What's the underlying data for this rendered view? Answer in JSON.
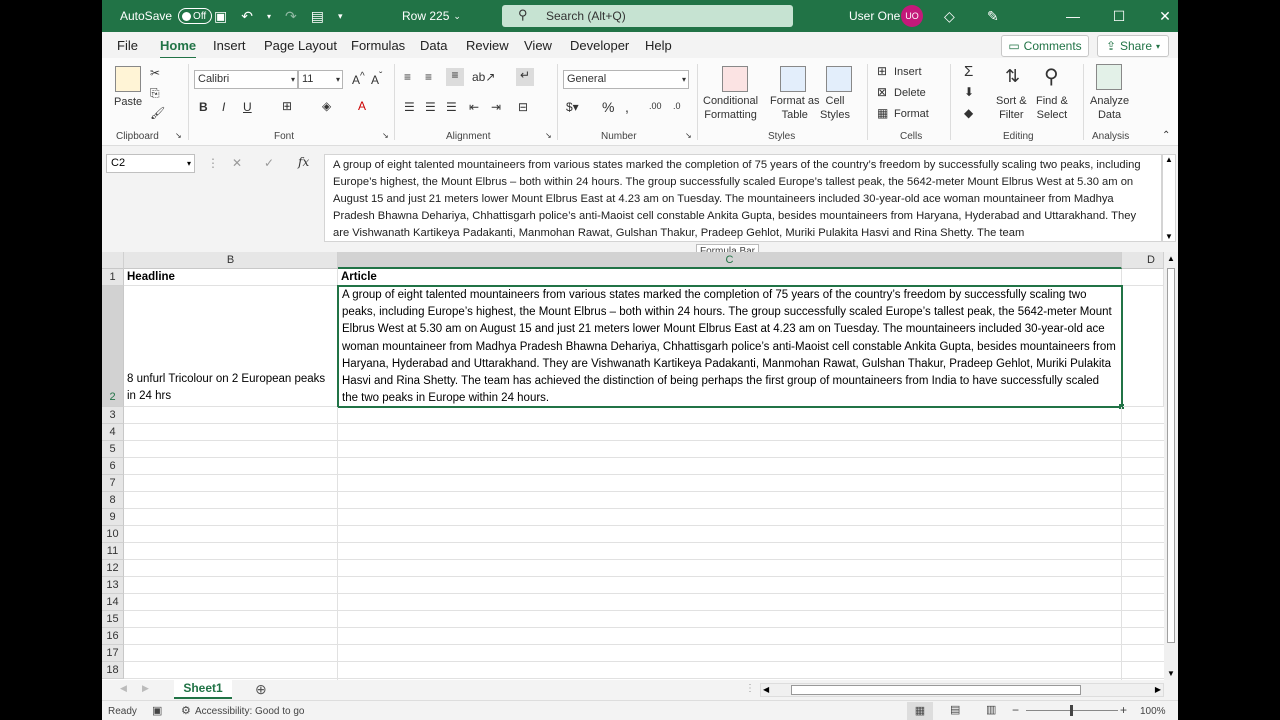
{
  "titlebar": {
    "autosave_label": "AutoSave",
    "autosave_state": "Off",
    "doc_title": "Row 225",
    "search_placeholder": "Search (Alt+Q)",
    "user_name": "User One",
    "user_initials": "UO"
  },
  "menu": {
    "tabs": [
      "File",
      "Home",
      "Insert",
      "Page Layout",
      "Formulas",
      "Data",
      "Review",
      "View",
      "Developer",
      "Help"
    ],
    "active": "Home",
    "comments": "Comments",
    "share": "Share"
  },
  "ribbon": {
    "clipboard": {
      "paste": "Paste",
      "label": "Clipboard"
    },
    "font": {
      "name": "Calibri",
      "size": "11",
      "label": "Font"
    },
    "alignment": {
      "label": "Alignment"
    },
    "number": {
      "format": "General",
      "label": "Number"
    },
    "styles": {
      "conditional_l1": "Conditional",
      "conditional_l2": "Formatting",
      "format_table_l1": "Format as",
      "format_table_l2": "Table",
      "cell_styles_l1": "Cell",
      "cell_styles_l2": "Styles",
      "label": "Styles"
    },
    "cells": {
      "insert": "Insert",
      "delete": "Delete",
      "format": "Format",
      "label": "Cells"
    },
    "editing": {
      "sort_l1": "Sort &",
      "sort_l2": "Filter",
      "find_l1": "Find &",
      "find_l2": "Select",
      "label": "Editing"
    },
    "analysis": {
      "analyze_l1": "Analyze",
      "analyze_l2": "Data",
      "label": "Analysis"
    }
  },
  "formula_bar": {
    "name_box": "C2",
    "content": "A group of eight talented mountaineers from various states marked the completion of 75 years of the country’s freedom by successfully scaling two peaks, including Europe’s highest, the Mount Elbrus – both within 24 hours. The group successfully scaled Europe’s tallest peak, the 5642-meter Mount Elbrus West at 5.30 am on August 15 and just 21 meters lower Mount Elbrus East at 4.23 am on Tuesday. The mountaineers included 30-year-old ace woman mountaineer from Madhya Pradesh Bhawna Dehariya, Chhattisgarh police’s anti-Maoist cell constable Ankita Gupta, besides mountaineers from Haryana, Hyderabad and Uttarakhand. They are Vishwanath Kartikeya Padakanti, Manmohan Rawat, Gulshan Thakur, Pradeep Gehlot, Muriki Pulakita Hasvi and Rina Shetty. The team",
    "tooltip": "Formula Bar"
  },
  "sheet": {
    "columns": [
      "B",
      "C",
      "D"
    ],
    "rows": [
      "1",
      "2",
      "3",
      "4",
      "5",
      "6",
      "7",
      "8",
      "9",
      "10",
      "11",
      "12",
      "13",
      "14",
      "15",
      "16",
      "17",
      "18"
    ],
    "cells": {
      "B1": "Headline",
      "C1": "Article",
      "B2": "8 unfurl Tricolour on 2 European peaks in 24 hrs",
      "C2": "A group of eight talented mountaineers from various states marked the completion of 75 years of the country’s freedom by successfully scaling two peaks, including Europe’s highest, the Mount Elbrus – both within 24 hours. The group successfully scaled Europe’s tallest peak, the 5642-meter Mount Elbrus West at 5.30 am on August 15 and just 21 meters lower Mount Elbrus East at 4.23 am on Tuesday. The mountaineers included 30-year-old ace woman mountaineer from Madhya Pradesh Bhawna Dehariya, Chhattisgarh police’s anti-Maoist cell constable Ankita Gupta, besides mountaineers from Haryana, Hyderabad and Uttarakhand. They are Vishwanath Kartikeya Padakanti, Manmohan Rawat, Gulshan Thakur, Pradeep Gehlot, Muriki Pulakita Hasvi and Rina Shetty. The team has achieved the distinction of being perhaps the first group of mountaineers from India to have successfully scaled the two peaks in Europe within 24 hours."
    },
    "active_sheet": "Sheet1"
  },
  "status": {
    "ready": "Ready",
    "accessibility": "Accessibility: Good to go",
    "zoom": "100%"
  },
  "colors": {
    "accent": "#217346",
    "avatar": "#c4197a"
  }
}
